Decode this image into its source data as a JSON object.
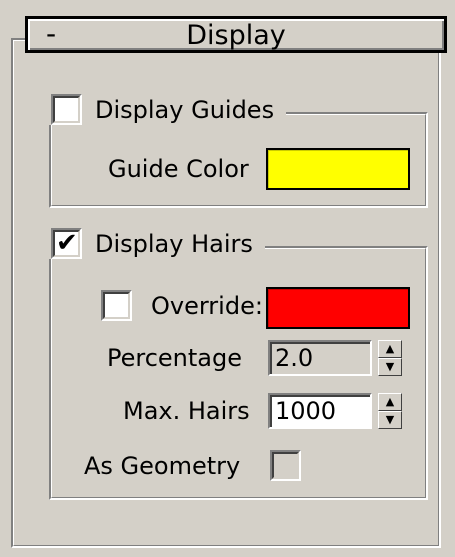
{
  "rollout": {
    "title": "Display",
    "toggle": "-"
  },
  "display_guides": {
    "label": "Display Guides",
    "checked": false,
    "guide_color_label": "Guide Color",
    "guide_color": "#ffff00"
  },
  "display_hairs": {
    "label": "Display Hairs",
    "checked": true,
    "checkmark": "✔",
    "override_label": "Override:",
    "override_checked": false,
    "override_color": "#ff0000",
    "percentage_label": "Percentage",
    "percentage_value": "2.0",
    "max_hairs_label": "Max. Hairs",
    "max_hairs_value": "1000",
    "as_geometry_label": "As Geometry",
    "as_geometry_checked": false
  },
  "icons": {
    "spinner_up": "▲",
    "spinner_down": "▼"
  }
}
